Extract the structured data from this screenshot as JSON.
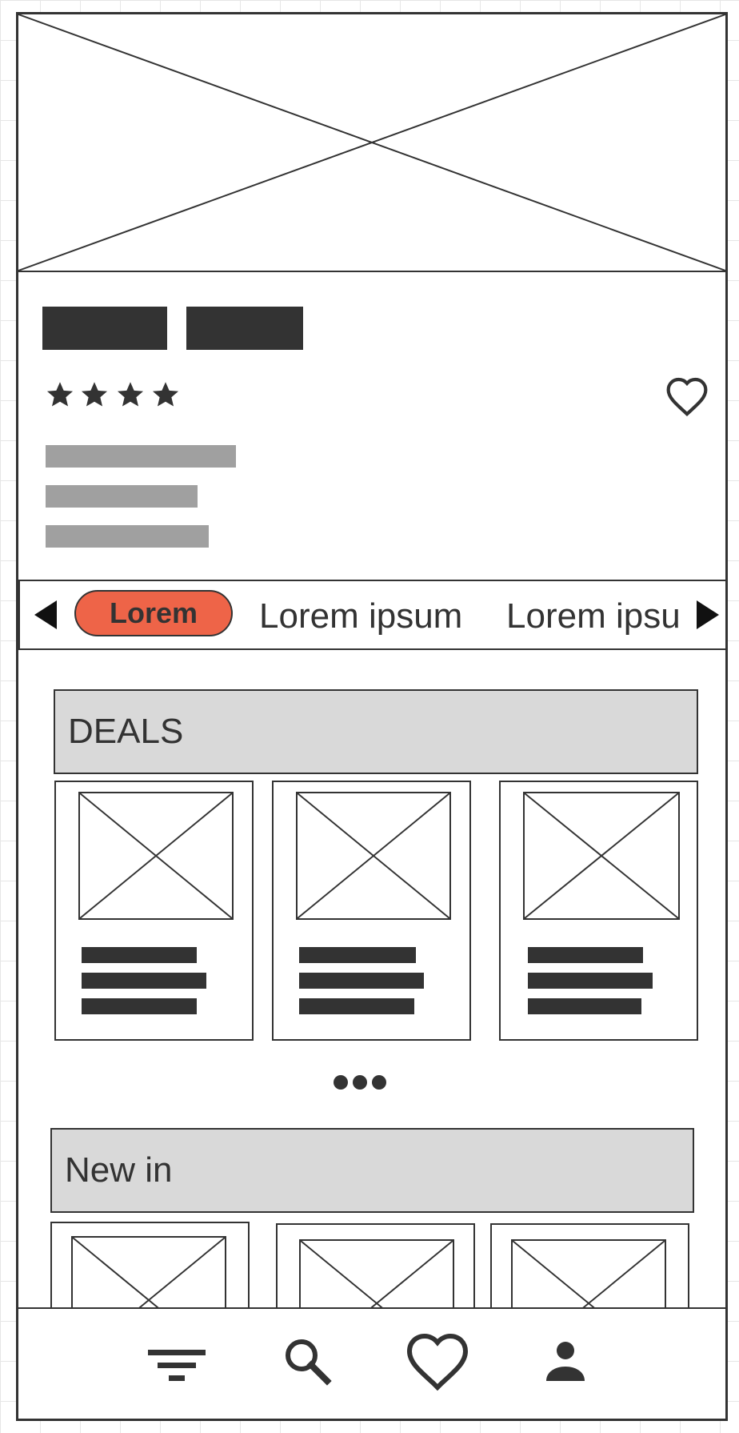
{
  "product": {
    "image_alt": "",
    "rating": 4,
    "favorite_icon": "heart-outline-icon"
  },
  "categories": {
    "prev_icon": "triangle-left-icon",
    "next_icon": "triangle-right-icon",
    "items": [
      {
        "label": "Lorem",
        "active": true
      },
      {
        "label": "Lorem ipsum",
        "active": false
      },
      {
        "label": "Lorem ipsu",
        "active": false
      }
    ]
  },
  "deals": {
    "title": "DEALS",
    "pagination_icon": "more-dots-icon"
  },
  "new_in": {
    "title": "New in"
  },
  "bottom_nav": {
    "items": [
      {
        "icon": "filter-icon"
      },
      {
        "icon": "search-icon"
      },
      {
        "icon": "heart-icon"
      },
      {
        "icon": "user-icon"
      }
    ]
  },
  "colors": {
    "accent": "#ee6448",
    "dark": "#333333",
    "placeholder_text": "#a0a0a0",
    "section_header_bg": "#d9d9d9"
  }
}
